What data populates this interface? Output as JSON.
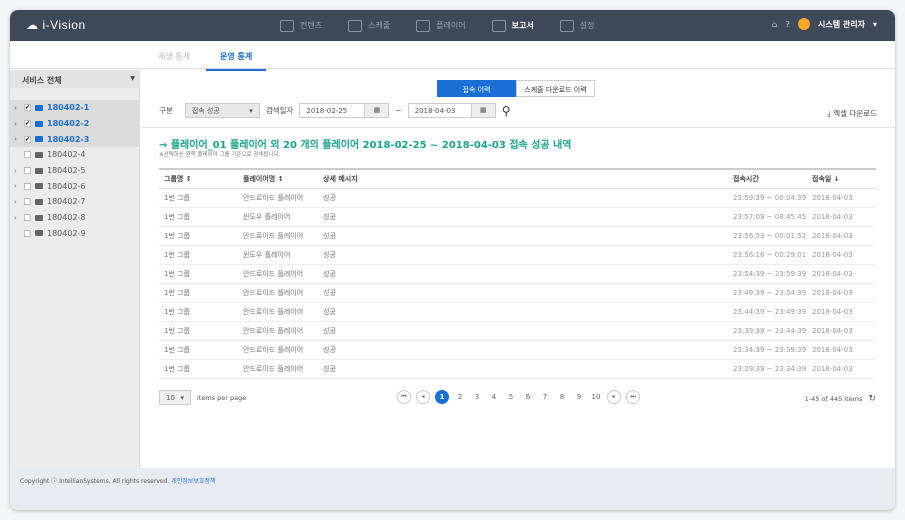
{
  "header": {
    "logo": "i-Vision",
    "nav": [
      {
        "label": "컨텐츠",
        "icon": "shapes-icon"
      },
      {
        "label": "스케줄",
        "icon": "calendar-icon"
      },
      {
        "label": "플레이어",
        "icon": "monitor-icon"
      },
      {
        "label": "보고서",
        "icon": "document-icon",
        "active": true
      },
      {
        "label": "설정",
        "icon": "gear-icon"
      }
    ],
    "user": "시스템 관리자"
  },
  "subnav": {
    "tabs": [
      "재생 통계",
      "운영 통계"
    ],
    "active": 1
  },
  "sidebar": {
    "select": "서비스 전체",
    "items": [
      {
        "label": "180402-1",
        "checked": true,
        "expand": true
      },
      {
        "label": "180402-2",
        "checked": true,
        "expand": true
      },
      {
        "label": "180402-3",
        "checked": true,
        "expand": true
      },
      {
        "label": "180402-4",
        "checked": false,
        "expand": false
      },
      {
        "label": "180402-5",
        "checked": false,
        "expand": true
      },
      {
        "label": "180402-6",
        "checked": false,
        "expand": true
      },
      {
        "label": "180402-7",
        "checked": false,
        "expand": true
      },
      {
        "label": "180402-8",
        "checked": false,
        "expand": true
      },
      {
        "label": "180402-9",
        "checked": false,
        "expand": false
      }
    ]
  },
  "main": {
    "tabs": [
      "접속 이력",
      "스케줄 다운로드 이력"
    ],
    "filter": {
      "type_label": "구분",
      "type_value": "접속 성공",
      "date_label": "검색일자",
      "from": "2018-02-25",
      "sep": "~",
      "to": "2018-04-03"
    },
    "excel": "엑셀 다운로드",
    "title": "→ 플레이어_01 플레이어 외 20 개의 플레이어 2018-02-25 ~ 2018-04-03 접속 성공 내역",
    "note": "※선택하신 왼쪽 플레이어 그룹 기준으로 검색됩니다.",
    "columns": [
      "그룹명 ↕",
      "플레이어명 ↕",
      "상세 메시지",
      "접속시간",
      "접속일 ↓"
    ],
    "rows": [
      [
        "1번 그룹",
        "안드로이드 플레이어",
        "성공",
        "23:59:39 ~ 00:04:39",
        "2018-04-03"
      ],
      [
        "1번 그룹",
        "윈도우 플레이어",
        "성공",
        "23:57:09 ~ 08:45:45",
        "2018-04-03"
      ],
      [
        "1번 그룹",
        "안드로이드 플레이어",
        "성공",
        "23:56:53 ~ 00:01:52",
        "2018-04-03"
      ],
      [
        "1번 그룹",
        "윈도우 플레이어",
        "성공",
        "23:56:16 ~ 00:29:01",
        "2018-04-03"
      ],
      [
        "1번 그룹",
        "안드로이드 플레이어",
        "성공",
        "23:54:39 ~ 23:59:39",
        "2018-04-03"
      ],
      [
        "1번 그룹",
        "안드로이드 플레이어",
        "성공",
        "23:49:39 ~ 23:54:39",
        "2018-04-03"
      ],
      [
        "1번 그룹",
        "안드로이드 플레이어",
        "성공",
        "23:44:39 ~ 23:49:39",
        "2018-04-03"
      ],
      [
        "1번 그룹",
        "안드로이드 플레이어",
        "성공",
        "23:39:39 ~ 23:44:39",
        "2018-04-03"
      ],
      [
        "1번 그룹",
        "안드로이드 플레이어",
        "성공",
        "23:34:39 ~ 23:39:39",
        "2018-04-03"
      ],
      [
        "1번 그룹",
        "안드로이드 플레이어",
        "성공",
        "23:29:39 ~ 23:34:39",
        "2018-04-03"
      ]
    ],
    "pager": {
      "per_page": "10",
      "per_page_label": "items per page",
      "pages": [
        "1",
        "2",
        "3",
        "4",
        "5",
        "6",
        "7",
        "8",
        "9",
        "10"
      ],
      "current": "1",
      "count": "1-45 of 445 items"
    }
  },
  "footer": {
    "copyright": "Copyright ⓘ IntellianSystems. All rights reserved.",
    "privacy": "개인정보보호정책"
  }
}
